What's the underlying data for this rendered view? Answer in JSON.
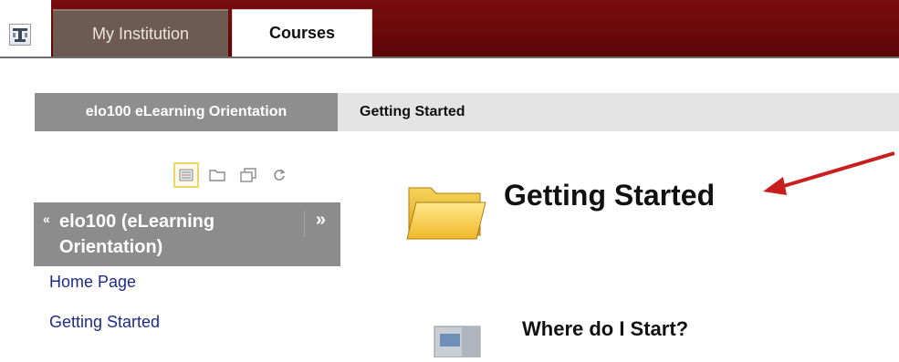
{
  "nav": {
    "tabs": [
      {
        "label": "My Institution"
      },
      {
        "label": "Courses"
      }
    ]
  },
  "breadcrumb": {
    "course": "elo100 eLearning Orientation",
    "current": "Getting Started"
  },
  "course_menu": {
    "title": "elo100 (eLearning Orientation)",
    "collapse_glyph": "«",
    "expand_glyph": "»",
    "items": [
      {
        "label": "Home Page"
      },
      {
        "label": "Getting Started"
      }
    ],
    "tool_icons": [
      "list-view-icon",
      "folder-view-icon",
      "new-window-icon",
      "refresh-icon"
    ]
  },
  "content": {
    "page_title": "Getting Started",
    "items": [
      {
        "title": "Where do I Start?",
        "icon": "document-icon"
      }
    ]
  },
  "colors": {
    "header_maroon": "#6b0a0c",
    "tab_inactive": "#6d5b52",
    "breadcrumb_course_bg": "#8e8e8e",
    "menu_link": "#1e2b8a",
    "annotation_arrow": "#c81e1e"
  }
}
